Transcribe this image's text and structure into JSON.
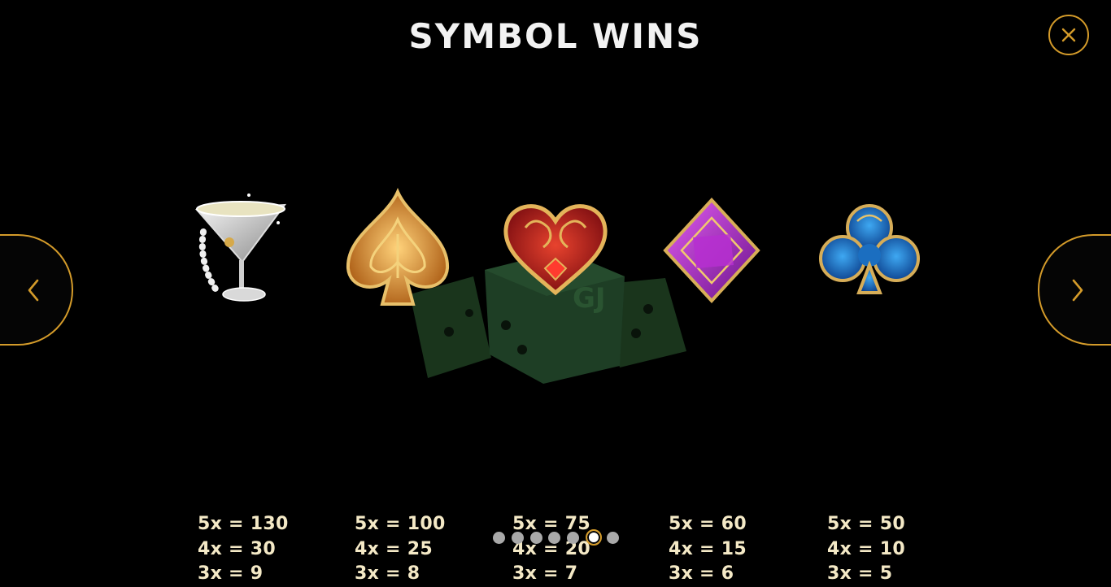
{
  "header": {
    "title": "SYMBOL WINS"
  },
  "controls": {
    "close_icon": "close-icon",
    "prev_icon": "chevron-left-icon",
    "next_icon": "chevron-right-icon",
    "accent_color": "#d49b2a"
  },
  "symbols": [
    {
      "name": "martini",
      "icon": "martini-glass-icon",
      "pays": [
        "5x = 130",
        "4x = 30",
        "3x = 9"
      ]
    },
    {
      "name": "spade",
      "icon": "spade-icon",
      "pays": [
        "5x = 100",
        "4x = 25",
        "3x = 8"
      ]
    },
    {
      "name": "heart",
      "icon": "heart-icon",
      "pays": [
        "5x = 75",
        "4x = 20",
        "3x = 7"
      ]
    },
    {
      "name": "diamond",
      "icon": "diamond-icon",
      "pays": [
        "5x = 60",
        "4x = 15",
        "3x = 6"
      ]
    },
    {
      "name": "club",
      "icon": "club-icon",
      "pays": [
        "5x = 50",
        "4x = 10",
        "3x = 5"
      ]
    }
  ],
  "pagination": {
    "total": 7,
    "current": 6
  },
  "watermark": {
    "icon": "dice-logo-icon",
    "color": "#1c3a1f"
  }
}
